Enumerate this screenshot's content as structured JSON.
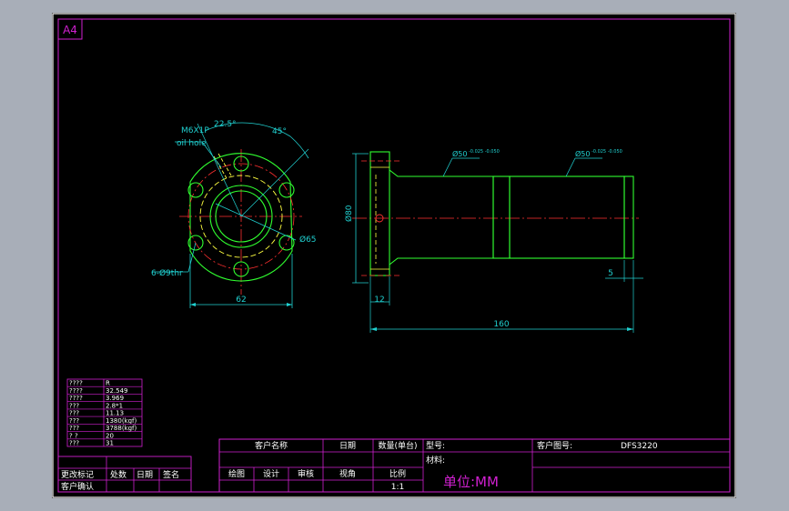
{
  "sheet": {
    "size_label": "A4"
  },
  "flange_view": {
    "thread_callout": "M6X1P",
    "hole_label": "oil hole",
    "angle_a": "22.5°",
    "angle_b": "45°",
    "bolt_circle": "Ø65",
    "holes": "6-Ø9thr",
    "width": "62"
  },
  "side_view": {
    "flange_dia": "Ø80",
    "dia_1": "Ø50",
    "dia_1_tol": "-0.025\n-0.050",
    "dia_2": "Ø50",
    "dia_2_tol": "-0.025\n-0.050",
    "flange_thickness": "12",
    "end_length": "5",
    "total_length": "160"
  },
  "spec_table": {
    "rows": [
      {
        "key": "????",
        "value": "R"
      },
      {
        "key": "????",
        "value": "32.549"
      },
      {
        "key": "????",
        "value": "3.969"
      },
      {
        "key": " ???",
        "value": "2.8*1"
      },
      {
        "key": " ???",
        "value": "11.13"
      },
      {
        "key": " ???",
        "value": "1380(kgf)"
      },
      {
        "key": " ???",
        "value": "3788(kgf)"
      },
      {
        "key": " ?  ?",
        "value": "20"
      },
      {
        "key": " ???",
        "value": "31"
      }
    ]
  },
  "title_block": {
    "change_record": "更改标记",
    "place_count": "处数",
    "date_left": "日期",
    "sign": "签名",
    "customer_confirm": "客户确认",
    "customer_name": "客户名称",
    "date": "日期",
    "quantity": "数量(单台)",
    "model": "型号:",
    "customer_drawing": "客户图号:",
    "drawing_no": "DFS3220",
    "drawn": "绘图",
    "designed": "设计",
    "checked": "审核",
    "approved": "视角",
    "scale": "比例",
    "scale_value": "1:1",
    "material": "材料:",
    "unit": "单位:MM"
  }
}
